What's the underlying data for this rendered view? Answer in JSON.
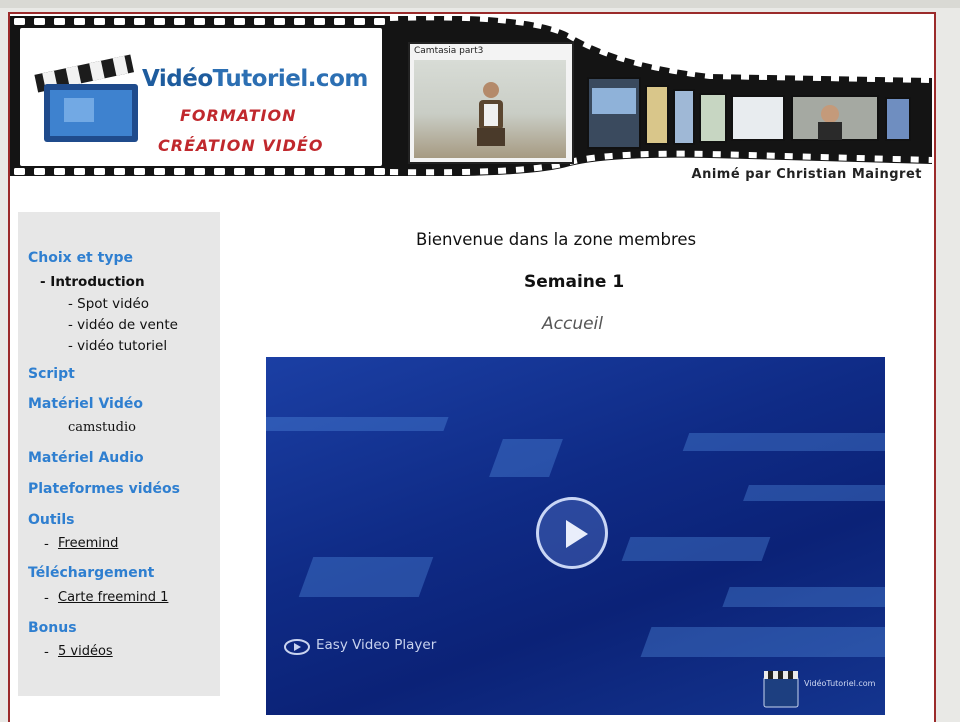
{
  "banner": {
    "brand_prefix": "Vidéo",
    "brand_suffix": "Tutoriel.com",
    "line1": "FORMATION",
    "line2": "CRÉATION VIDÉO",
    "camtasia_title": "Camtasia part3",
    "animator": "Animé par Christian Maingret"
  },
  "sidebar": {
    "choix": "Choix et type",
    "introduction": "- Introduction",
    "spot": "- Spot vidéo",
    "vente": "- vidéo de vente",
    "tutoriel": "- vidéo tutoriel",
    "script": "Script",
    "materiel_video": "Matériel Vidéo",
    "camstudio": "camstudio",
    "materiel_audio": "Matériel Audio",
    "plateformes": "Plateformes vidéos",
    "outils": "Outils",
    "freemind": "Freemind",
    "telechargement": "Téléchargement",
    "carte": "Carte freemind 1",
    "bonus": "Bonus",
    "videos": "5 vidéos"
  },
  "main": {
    "welcome": "Bienvenue dans la zone membres",
    "week": "Semaine 1",
    "accueil": "Accueil",
    "player_label": "Easy Video Player",
    "corner_logo_text": "VidéoTutoriel.com"
  }
}
